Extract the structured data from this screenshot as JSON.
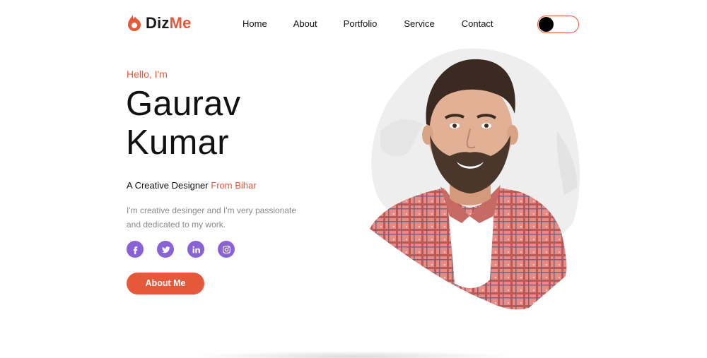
{
  "brand": {
    "name_part1": "Diz",
    "name_part2": "Me",
    "accent": "#e5583a"
  },
  "nav": {
    "items": [
      "Home",
      "About",
      "Portfolio",
      "Service",
      "Contact"
    ]
  },
  "toggle": {
    "icon": "theme-toggle"
  },
  "hero": {
    "greeting": "Hello, I'm",
    "name_line1": "Gaurav",
    "name_line2": "Kumar",
    "tagline_main": "A Creative Designer",
    "tagline_accent": "From Bihar",
    "description": "I'm creative desinger and I'm very passionate and dedicated to my work.",
    "cta_label": "About Me"
  },
  "socials": [
    {
      "icon": "facebook-icon"
    },
    {
      "icon": "twitter-icon"
    },
    {
      "icon": "linkedin-icon"
    },
    {
      "icon": "instagram-icon"
    }
  ],
  "colors": {
    "accent": "#e5583a",
    "social": "#8a62d8",
    "text": "#111111",
    "muted": "#8a8a8a"
  }
}
